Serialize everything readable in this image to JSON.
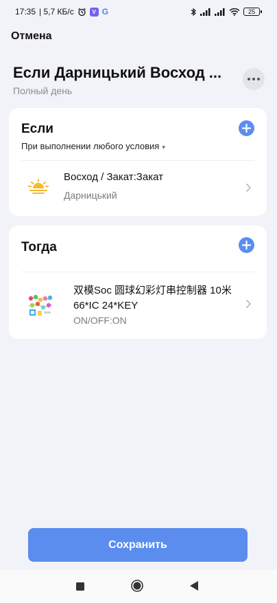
{
  "status_bar": {
    "time": "17:35",
    "speed": "| 5,7 КБ/с",
    "alarm_icon": "alarm-icon",
    "viber_icon": "viber-icon",
    "g_icon": "G",
    "battery": "25"
  },
  "header": {
    "cancel_label": "Отмена",
    "title": "Если Дарницький Восход ...",
    "subtitle": "Полный день"
  },
  "if_card": {
    "heading": "Если",
    "condition_mode": "При выполнении любого условия",
    "condition": {
      "title": "Восход / Закат:Закат",
      "subtitle": "Дарницький",
      "icon": "sunset-icon"
    }
  },
  "then_card": {
    "heading": "Тогда",
    "action": {
      "title_line1": "双模Soc 圆球幻彩灯串控制器 10米",
      "title_line2": "66*IC 24*KEY",
      "subtitle": "ON/OFF:ON",
      "icon": "device-thumbnail"
    }
  },
  "save_label": "Сохранить",
  "colors": {
    "accent": "#5b8def",
    "background": "#f2f3f8",
    "sun": "#f5b82e"
  }
}
